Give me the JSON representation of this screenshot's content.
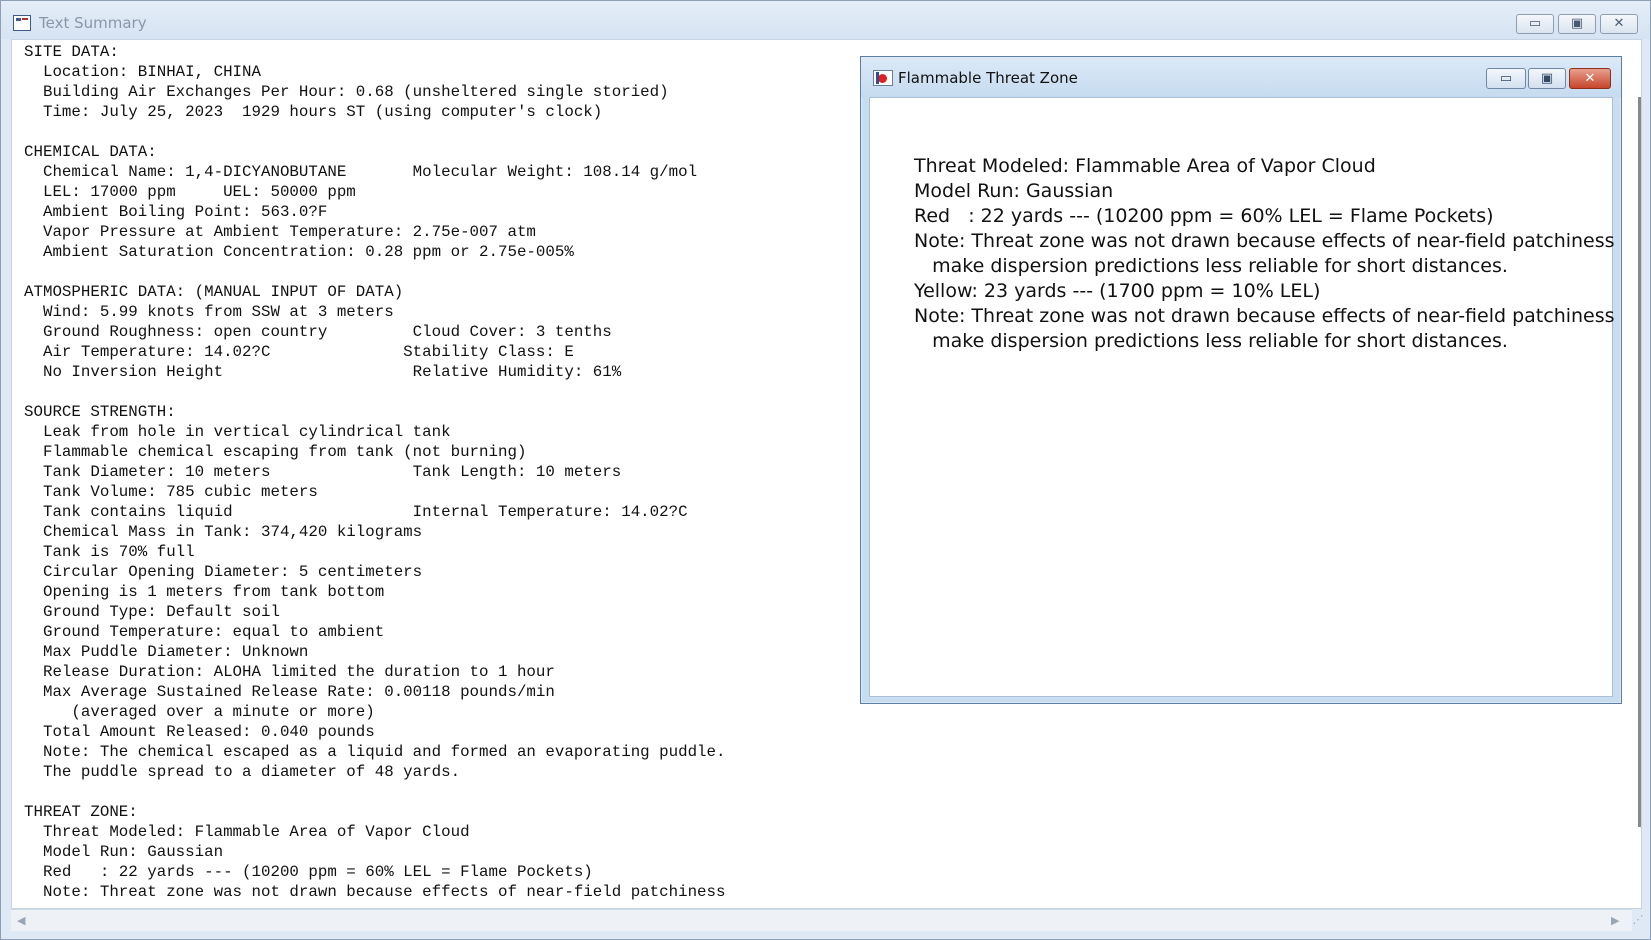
{
  "main_window": {
    "title": "Text Summary",
    "minimize_glyph": "▭",
    "maximize_glyph": "▣",
    "close_glyph": "✕",
    "summary_text": "SITE DATA:\n  Location: BINHAI, CHINA\n  Building Air Exchanges Per Hour: 0.68 (unsheltered single storied)\n  Time: July 25, 2023  1929 hours ST (using computer's clock)\n\nCHEMICAL DATA:\n  Chemical Name: 1,4-DICYANOBUTANE       Molecular Weight: 108.14 g/mol\n  LEL: 17000 ppm     UEL: 50000 ppm\n  Ambient Boiling Point: 563.0?F\n  Vapor Pressure at Ambient Temperature: 2.75e-007 atm\n  Ambient Saturation Concentration: 0.28 ppm or 2.75e-005%\n\nATMOSPHERIC DATA: (MANUAL INPUT OF DATA)\n  Wind: 5.99 knots from SSW at 3 meters\n  Ground Roughness: open country         Cloud Cover: 3 tenths\n  Air Temperature: 14.02?C              Stability Class: E\n  No Inversion Height                    Relative Humidity: 61%\n\nSOURCE STRENGTH:\n  Leak from hole in vertical cylindrical tank\n  Flammable chemical escaping from tank (not burning)\n  Tank Diameter: 10 meters               Tank Length: 10 meters\n  Tank Volume: 785 cubic meters\n  Tank contains liquid                   Internal Temperature: 14.02?C\n  Chemical Mass in Tank: 374,420 kilograms\n  Tank is 70% full\n  Circular Opening Diameter: 5 centimeters\n  Opening is 1 meters from tank bottom\n  Ground Type: Default soil\n  Ground Temperature: equal to ambient\n  Max Puddle Diameter: Unknown\n  Release Duration: ALOHA limited the duration to 1 hour\n  Max Average Sustained Release Rate: 0.00118 pounds/min\n     (averaged over a minute or more)\n  Total Amount Released: 0.040 pounds\n  Note: The chemical escaped as a liquid and formed an evaporating puddle.\n  The puddle spread to a diameter of 48 yards.\n\nTHREAT ZONE:\n  Threat Modeled: Flammable Area of Vapor Cloud\n  Model Run: Gaussian\n  Red   : 22 yards --- (10200 ppm = 60% LEL = Flame Pockets)\n  Note: Threat zone was not drawn because effects of near-field patchiness",
    "scroll_left_glyph": "◀",
    "scroll_right_glyph": "▶",
    "size_grip_glyph": "⋰"
  },
  "threat_window": {
    "title": "Flammable Threat Zone",
    "minimize_glyph": "▭",
    "maximize_glyph": "▣",
    "close_glyph": "✕",
    "text": "Threat Modeled: Flammable Area of Vapor Cloud\nModel Run: Gaussian\nRed   : 22 yards --- (10200 ppm = 60% LEL = Flame Pockets)\nNote: Threat zone was not drawn because effects of near-field patchiness\n   make dispersion predictions less reliable for short distances.\nYellow: 23 yards --- (1700 ppm = 10% LEL)\nNote: Threat zone was not drawn because effects of near-field patchiness\n   make dispersion predictions less reliable for short distances."
  },
  "colors": {
    "frame": "#dfe9f5",
    "threat_frame": "#c9ddf1",
    "close_red": "#c7452c"
  }
}
